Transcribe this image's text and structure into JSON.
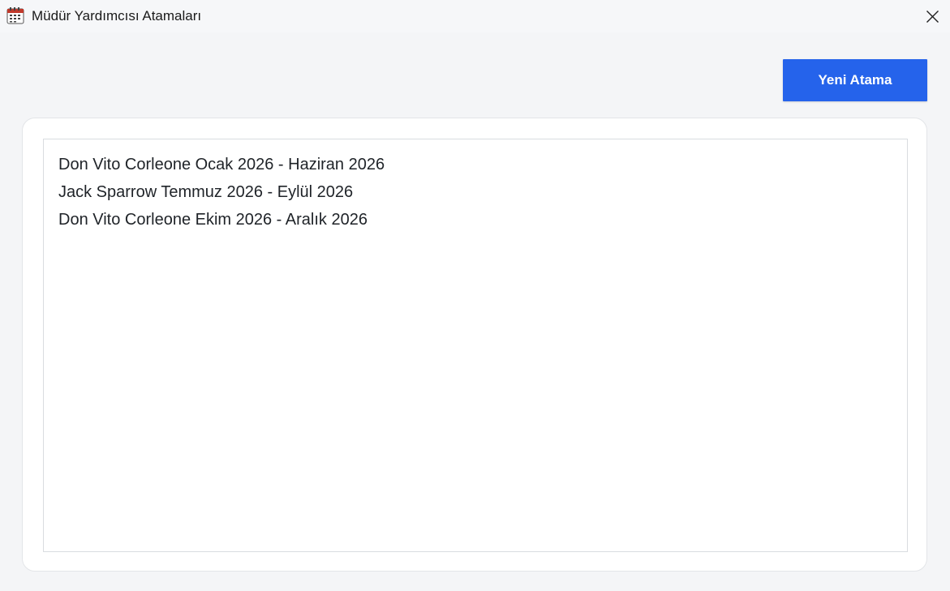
{
  "window": {
    "title": "Müdür Yardımcısı Atamaları",
    "app_icon": "calendar-icon",
    "close_icon": "close-icon"
  },
  "toolbar": {
    "new_assignment_label": "Yeni Atama",
    "accent_color": "#2563eb"
  },
  "assignments": [
    "Don Vito Corleone Ocak 2026 - Haziran 2026",
    "Jack Sparrow Temmuz 2026 - Eylül 2026",
    "Don Vito Corleone Ekim 2026 - Aralık 2026"
  ]
}
